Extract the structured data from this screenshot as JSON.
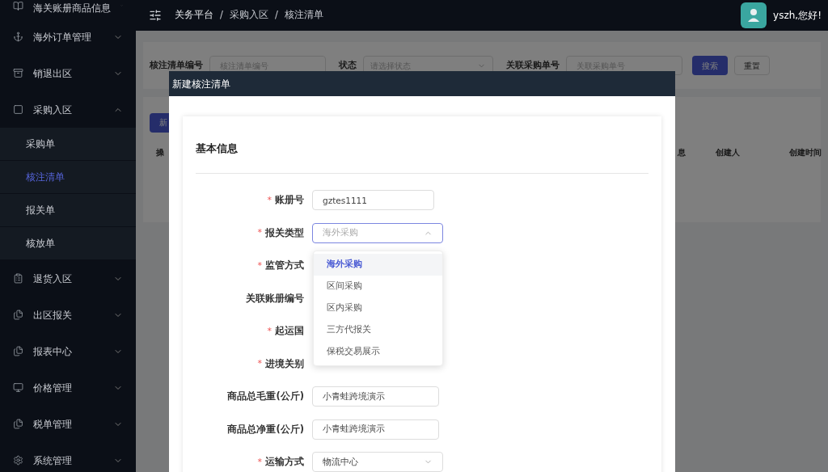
{
  "sidebar": {
    "items": [
      {
        "label": "海关账册商品信息",
        "expanded": false
      },
      {
        "label": "海外订单管理",
        "expanded": false
      },
      {
        "label": "销退出区",
        "expanded": false
      },
      {
        "label": "采购入区",
        "expanded": true,
        "children": [
          {
            "label": "采购单",
            "selected": false
          },
          {
            "label": "核注清单",
            "selected": true
          },
          {
            "label": "报关单",
            "selected": false
          },
          {
            "label": "核放单",
            "selected": false
          }
        ]
      },
      {
        "label": "退货入区",
        "expanded": false
      },
      {
        "label": "出区报关",
        "expanded": false
      },
      {
        "label": "报表中心",
        "expanded": false
      },
      {
        "label": "价格管理",
        "expanded": false
      },
      {
        "label": "税单管理",
        "expanded": false
      },
      {
        "label": "系统管理",
        "expanded": false
      }
    ]
  },
  "header": {
    "breadcrumb": [
      {
        "kind": "crumb",
        "text": "关务平台"
      },
      {
        "kind": "separator",
        "text": "/"
      },
      {
        "kind": "crumb",
        "text": "采购入区"
      },
      {
        "kind": "separator",
        "text": "/"
      },
      {
        "kind": "crumb",
        "text": "核注清单"
      }
    ],
    "greeting": "yszh,您好!"
  },
  "search": {
    "fields": [
      {
        "label": "核注清单编号",
        "kind": "input",
        "placeholder": "核注清单编号"
      },
      {
        "label": "状态",
        "kind": "select",
        "placeholder": "请选择状态"
      },
      {
        "label": "关联采购单号",
        "kind": "input",
        "placeholder": "关联采购单号"
      }
    ],
    "buttons": [
      {
        "label": "搜索",
        "kind": "primary"
      },
      {
        "label": "重置",
        "kind": "default"
      }
    ]
  },
  "table": {
    "new_button": "新",
    "columns": [
      "操",
      "息",
      "创建人",
      "创建时间"
    ]
  },
  "dialog": {
    "title": "新建核注清单",
    "section": "基本信息",
    "rows": [
      {
        "label": "账册号",
        "required_mark": "*",
        "kind": "input",
        "value": "gztes1111"
      },
      {
        "label": "报关类型",
        "required_mark": "*",
        "kind": "select",
        "placeholder": "海外采购",
        "expanded": true
      },
      {
        "label": "监管方式",
        "required_mark": "*",
        "kind": "covered"
      },
      {
        "label": "关联账册编号",
        "kind": "covered"
      },
      {
        "label": "起运国",
        "required_mark": "*",
        "kind": "covered"
      },
      {
        "label": "进境关别",
        "required_mark": "*",
        "kind": "covered"
      },
      {
        "label": "商品总毛重(公斤)",
        "kind": "input",
        "value": "小青蛙跨境演示"
      },
      {
        "label": "商品总净重(公斤)",
        "kind": "input",
        "value": "小青蛙跨境演示"
      },
      {
        "label": "运输方式",
        "required_mark": "*",
        "kind": "select",
        "value": "物流中心",
        "expanded": false
      }
    ],
    "dropdown": [
      {
        "label": "海外采购",
        "selected": true
      },
      {
        "label": "区间采购",
        "selected": false
      },
      {
        "label": "区内采购",
        "selected": false
      },
      {
        "label": "三方代报关",
        "selected": false
      },
      {
        "label": "保税交易展示",
        "selected": false
      }
    ]
  }
}
